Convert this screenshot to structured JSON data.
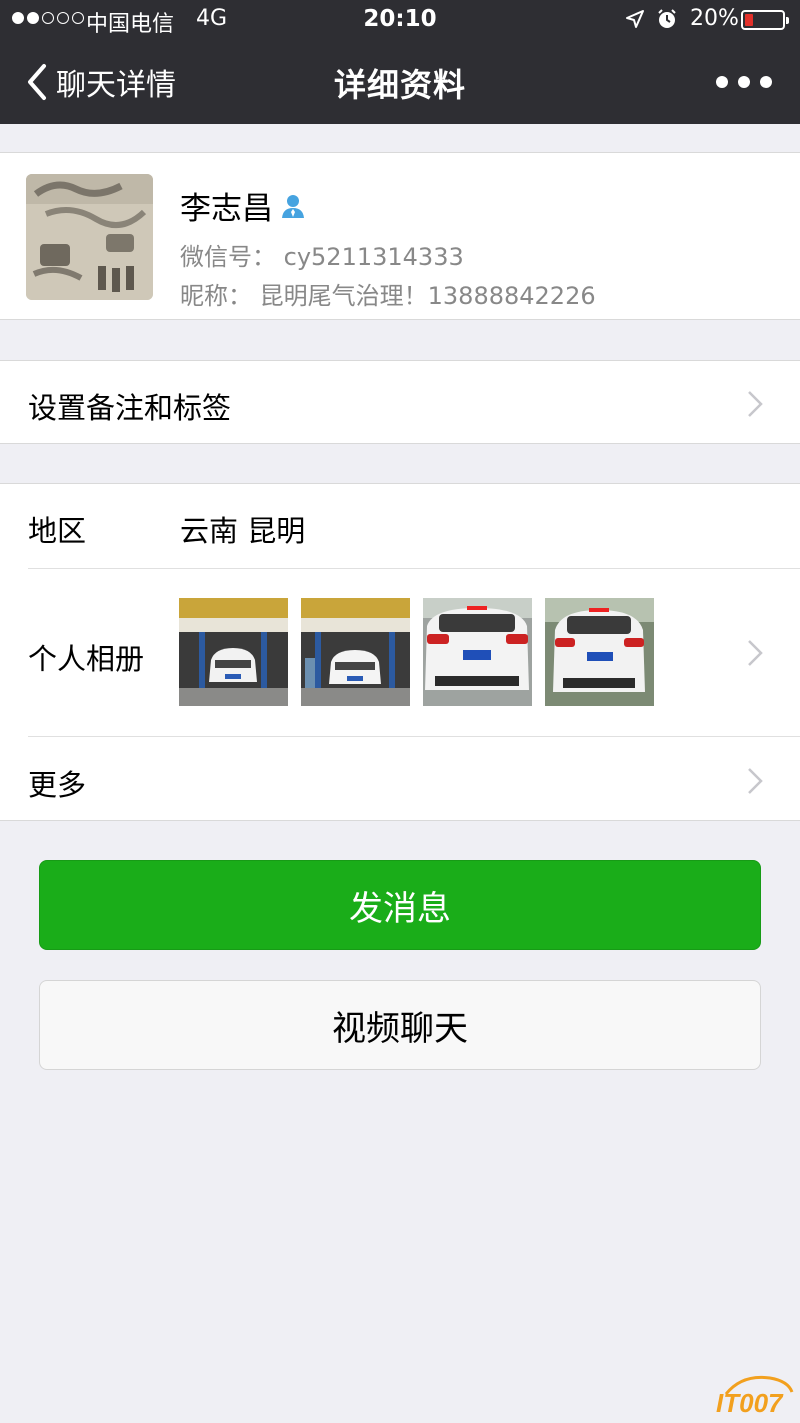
{
  "status_bar": {
    "carrier": "中国电信",
    "network": "4G",
    "time": "20:10",
    "battery": "20%",
    "signal_bars_filled": 2,
    "signal_bars_total": 5,
    "battery_level": 0.2,
    "icons": [
      "location-arrow-icon",
      "alarm-clock-icon",
      "battery-icon"
    ]
  },
  "nav": {
    "back_label": "聊天详情",
    "title": "详细资料",
    "more_icon": "ellipsis-icon"
  },
  "profile": {
    "name": "李志昌",
    "wechat_id_label": "微信号：",
    "wechat_id": "cy5211314333",
    "nickname_label": "昵称：",
    "nickname": "昆明尾气治理！13888842226",
    "gender_icon": "male-icon"
  },
  "remark": {
    "label": "设置备注和标签"
  },
  "info": {
    "region_label": "地区",
    "region_value": "云南  昆明",
    "album_label": "个人相册",
    "album_photos": [
      "garage-white-suv-photo",
      "garage-white-suv-photo",
      "white-suv-rear-photo",
      "white-suv-rear-photo"
    ],
    "more_label": "更多"
  },
  "buttons": {
    "send_message": "发消息",
    "video_chat": "视频聊天"
  },
  "watermark": "IT007",
  "colors": {
    "nav_bg": "#2e2e33",
    "page_bg": "#efeff4",
    "primary_green": "#1aad19",
    "secondary_text": "#888888",
    "battery_low": "#e2302a"
  }
}
